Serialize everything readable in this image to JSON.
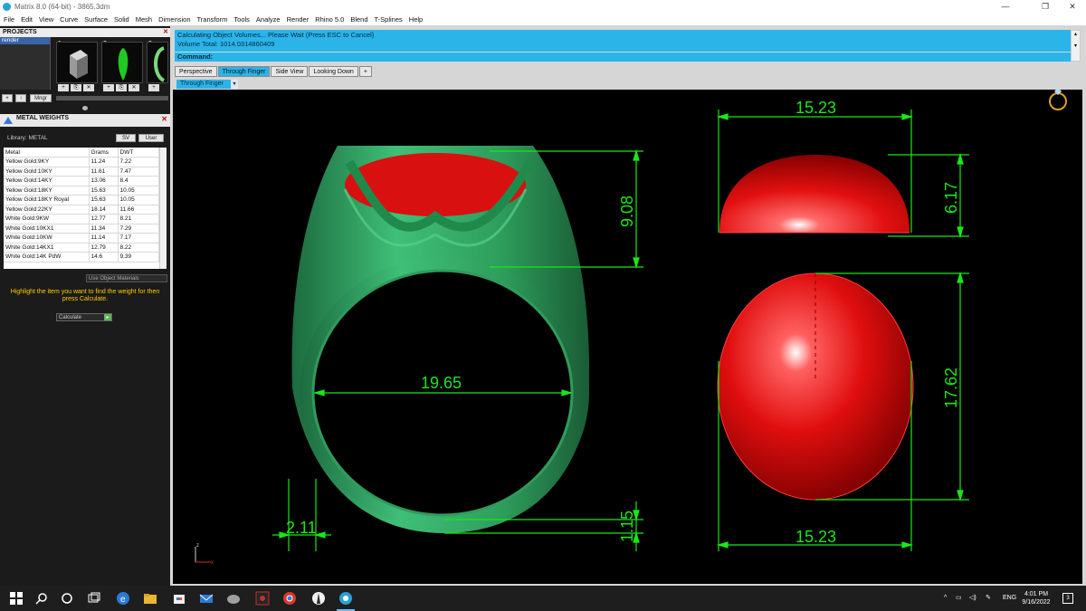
{
  "window": {
    "title": "Matrix 8.0 (64-bit) - 3865.3dm",
    "minimize": "—",
    "restore": "❐",
    "close": "✕"
  },
  "menu": [
    "File",
    "Edit",
    "View",
    "Curve",
    "Surface",
    "Solid",
    "Mesh",
    "Dimension",
    "Transform",
    "Tools",
    "Analyze",
    "Render",
    "Rhino 5.0",
    "Blend",
    "T-Splines",
    "Help"
  ],
  "projects": {
    "title": "PROJECTS",
    "selected": "render",
    "thumb_numbers": [
      "1",
      "2",
      "3"
    ],
    "thumb_buttons": [
      "+",
      "⎘",
      "✕"
    ],
    "bottom_buttons": [
      "+",
      "↑",
      "Mngr"
    ]
  },
  "metal_weights": {
    "title": "METAL WEIGHTS",
    "library_label": "Library: METAL",
    "sv_button": "SV",
    "user_button": "User",
    "columns": [
      "Metal",
      "Grams",
      "DWT"
    ],
    "rows": [
      [
        "Yellow Gold:9KY",
        "11.24",
        "7.22"
      ],
      [
        "Yellow Gold:10KY",
        "11.61",
        "7.47"
      ],
      [
        "Yellow Gold:14KY",
        "13.06",
        "8.4"
      ],
      [
        "Yellow Gold:18KY",
        "15.63",
        "10.05"
      ],
      [
        "Yellow Gold:18KY Royal",
        "15.63",
        "10.05"
      ],
      [
        "Yellow Gold:22KY",
        "18.14",
        "11.66"
      ],
      [
        "White Gold:9KW",
        "12.77",
        "8.21"
      ],
      [
        "White Gold:10KX1",
        "11.34",
        "7.29"
      ],
      [
        "White Gold:10KW",
        "11.14",
        "7.17"
      ],
      [
        "White Gold:14KX1",
        "12.79",
        "8.22"
      ],
      [
        "White Gold:14K PdW",
        "14.6",
        "9.39"
      ]
    ],
    "use_object_materials": "Use Object Materials",
    "hint": "Highlight the item you want to find the weight for then press Calculate.",
    "calculate_label": "Calculate"
  },
  "command": {
    "line1": "Calculating Object Volumes... Please Wait (Press ESC to Cancel)",
    "line2": "Volume Total: 1014.0314860409",
    "prompt": "Command:"
  },
  "tabs": [
    "Perspective",
    "Through Finger",
    "Side View",
    "Looking Down",
    "+"
  ],
  "active_tab": "Through Finger",
  "viewport_label": "Through Finger",
  "dimensions": {
    "stone_width_top": "15.23",
    "stone_height_side": "6.17",
    "ring_top_height": "9.08",
    "inner_diameter": "19.65",
    "stone_length": "17.62",
    "stone_width_bottom": "15.23",
    "shank_width": "2.11",
    "shank_thickness": "1.15"
  },
  "colors": {
    "dimension": "#18e818",
    "stone": "#e01010",
    "metal": "#2e9e5c",
    "accent": "#2ab4e8"
  },
  "taskbar": {
    "language": "ENG",
    "time": "4:01 PM",
    "date": "9/16/2022",
    "tray_arrow": "^",
    "notifications": "3"
  }
}
